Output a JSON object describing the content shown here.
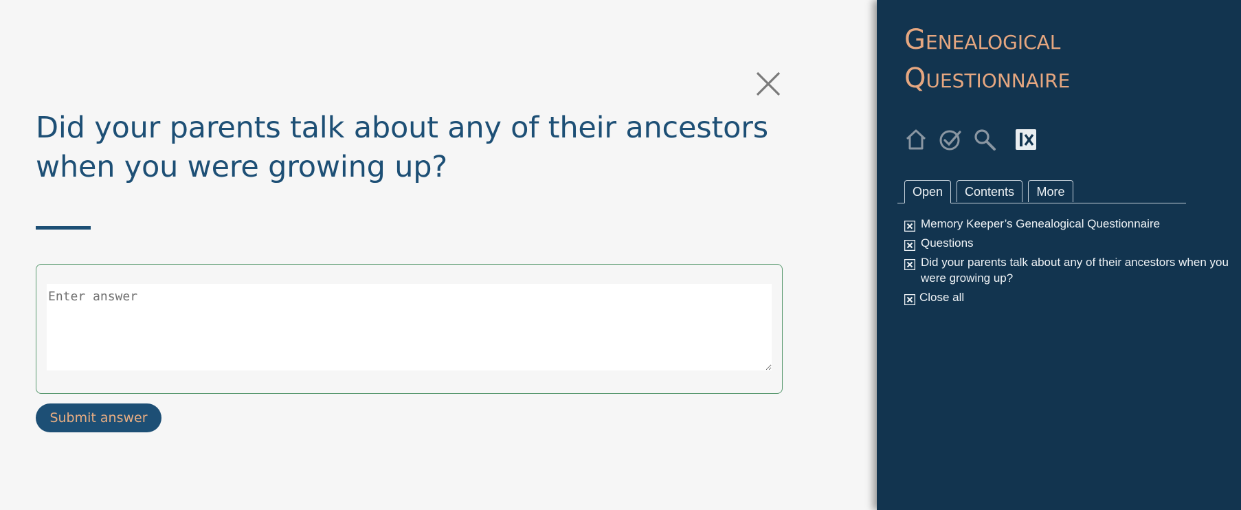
{
  "main": {
    "question": "Did your parents talk about any of their ancestors when you were growing up?",
    "answer_placeholder": "Enter answer",
    "answer_value": "",
    "submit_label": "Submit answer",
    "close_icon": "close-icon"
  },
  "sidebar": {
    "title_line1": "Genealogical",
    "title_line2": "Questionnaire",
    "icons": [
      "home-icon",
      "check-circle-icon",
      "search-icon",
      "close-panel-icon"
    ],
    "tabs": [
      {
        "label": "Open",
        "active": true
      },
      {
        "label": "Contents",
        "active": false
      },
      {
        "label": "More",
        "active": false
      }
    ],
    "open_items": [
      "Memory Keeper’s Genealogical Questionnaire",
      "Questions",
      "Did your parents talk about any of their ancestors when you were growing up?"
    ],
    "close_all_label": "Close all"
  },
  "colors": {
    "accent": "#1d4f75",
    "sidebar_bg": "#12344f",
    "title_orange": "#e6a780",
    "border_green": "#5a9a70"
  }
}
